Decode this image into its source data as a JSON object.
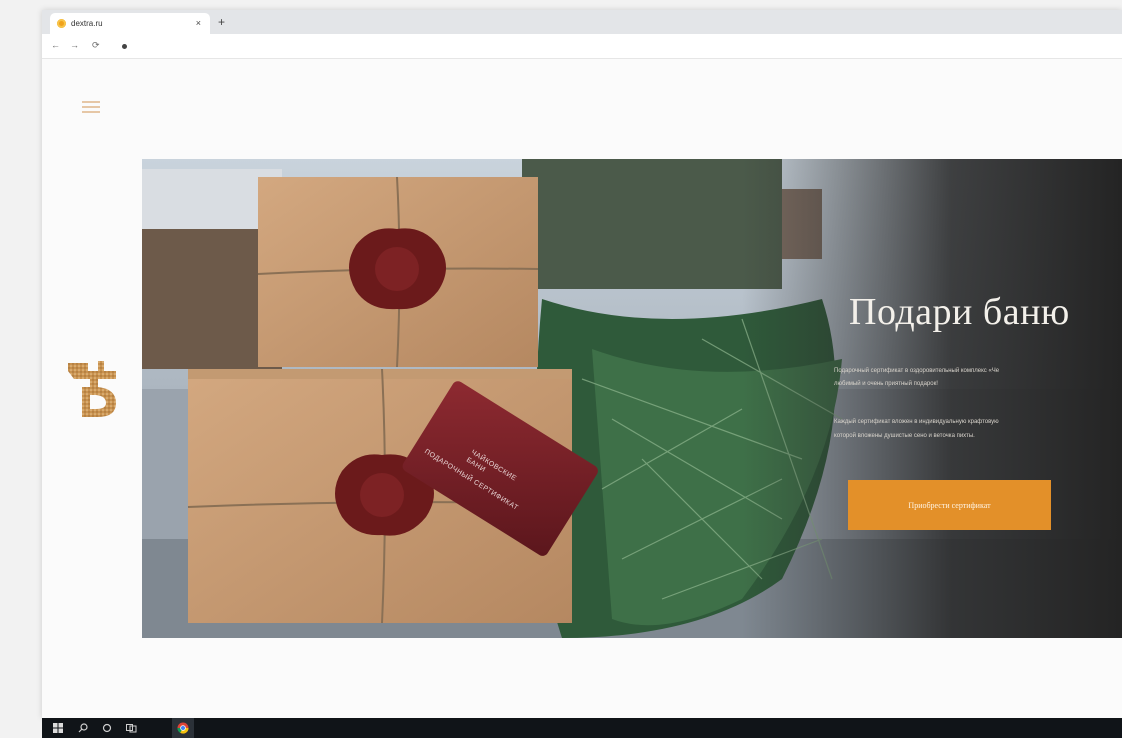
{
  "browser": {
    "tab": {
      "title": "dextra.ru",
      "favicon": "site-favicon",
      "close_label": "×"
    },
    "new_tab_label": "+",
    "nav": {
      "back": "←",
      "forward": "→",
      "reload": "⟳"
    }
  },
  "page": {
    "menu_icon": "hamburger-menu-icon",
    "logo_icon": "brand-logo",
    "hero": {
      "title": "Подари баню",
      "paragraph1_line1": "Подарочный сертификат в оздоровительный комплекс «Че",
      "paragraph1_line2": "любимый и очень приятный подарок!",
      "paragraph2_line1": "Каждый сертификат вложен в индивидуальную крафтовую",
      "paragraph2_line2": "которой вложены душистые сено и веточка пихты.",
      "cta_label": "Приобрести сертификат",
      "card_text_1": "ЧАЙКОВСКИЕ",
      "card_text_2": "БАНИ",
      "card_text_3": "ПОДАРОЧНЫЙ СЕРТИФИКАТ"
    }
  },
  "taskbar": {
    "icons": [
      "windows-start-icon",
      "search-icon",
      "cortana-icon",
      "task-view-icon",
      "chrome-icon"
    ]
  },
  "colors": {
    "accent": "#e39029",
    "hero_dark": "#2a2a2a",
    "kraft": "#c99e74",
    "wax": "#6b1a1b"
  }
}
